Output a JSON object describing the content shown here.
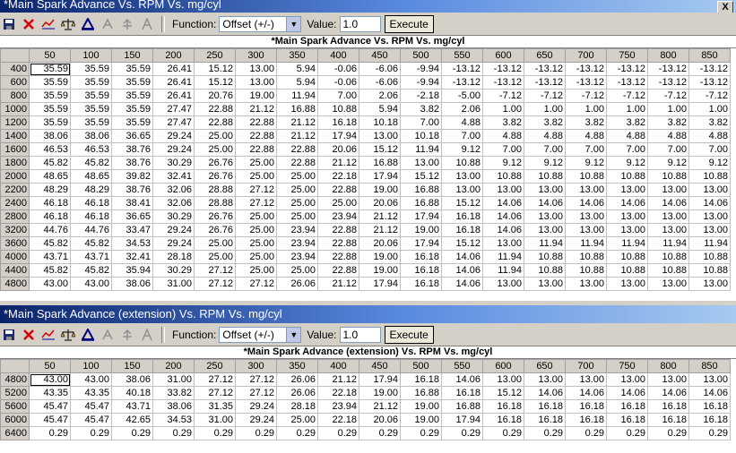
{
  "toolbar": {
    "function_label": "Function:",
    "function_value": "Offset (+/-)",
    "value_label": "Value:",
    "value_value": "1.0",
    "execute_label": "Execute",
    "close_glyph": "X"
  },
  "columns": [
    "50",
    "100",
    "150",
    "200",
    "250",
    "300",
    "350",
    "400",
    "450",
    "500",
    "550",
    "600",
    "650",
    "700",
    "750",
    "800",
    "850"
  ],
  "window1": {
    "title": "*Main Spark Advance Vs. RPM Vs. mg/cyl",
    "table_title": "*Main Spark Advance Vs. RPM Vs. mg/cyl",
    "rows": [
      {
        "rpm": "400",
        "values": [
          "35.59",
          "35.59",
          "35.59",
          "26.41",
          "15.12",
          "13.00",
          "5.94",
          "-0.06",
          "-6.06",
          "-9.94",
          "-13.12",
          "-13.12",
          "-13.12",
          "-13.12",
          "-13.12",
          "-13.12",
          "-13.12"
        ]
      },
      {
        "rpm": "600",
        "values": [
          "35.59",
          "35.59",
          "35.59",
          "26.41",
          "15.12",
          "13.00",
          "5.94",
          "-0.06",
          "-6.06",
          "-9.94",
          "-13.12",
          "-13.12",
          "-13.12",
          "-13.12",
          "-13.12",
          "-13.12",
          "-13.12"
        ]
      },
      {
        "rpm": "800",
        "values": [
          "35.59",
          "35.59",
          "35.59",
          "26.41",
          "20.76",
          "19.00",
          "11.94",
          "7.00",
          "2.06",
          "-2.18",
          "-5.00",
          "-7.12",
          "-7.12",
          "-7.12",
          "-7.12",
          "-7.12",
          "-7.12"
        ]
      },
      {
        "rpm": "1000",
        "values": [
          "35.59",
          "35.59",
          "35.59",
          "27.47",
          "22.88",
          "21.12",
          "16.88",
          "10.88",
          "5.94",
          "3.82",
          "2.06",
          "1.00",
          "1.00",
          "1.00",
          "1.00",
          "1.00",
          "1.00"
        ]
      },
      {
        "rpm": "1200",
        "values": [
          "35.59",
          "35.59",
          "35.59",
          "27.47",
          "22.88",
          "22.88",
          "21.12",
          "16.18",
          "10.18",
          "7.00",
          "4.88",
          "3.82",
          "3.82",
          "3.82",
          "3.82",
          "3.82",
          "3.82"
        ]
      },
      {
        "rpm": "1400",
        "values": [
          "38.06",
          "38.06",
          "36.65",
          "29.24",
          "25.00",
          "22.88",
          "21.12",
          "17.94",
          "13.00",
          "10.18",
          "7.00",
          "4.88",
          "4.88",
          "4.88",
          "4.88",
          "4.88",
          "4.88"
        ]
      },
      {
        "rpm": "1600",
        "values": [
          "46.53",
          "46.53",
          "38.76",
          "29.24",
          "25.00",
          "22.88",
          "22.88",
          "20.06",
          "15.12",
          "11.94",
          "9.12",
          "7.00",
          "7.00",
          "7.00",
          "7.00",
          "7.00",
          "7.00"
        ]
      },
      {
        "rpm": "1800",
        "values": [
          "45.82",
          "45.82",
          "38.76",
          "30.29",
          "26.76",
          "25.00",
          "22.88",
          "21.12",
          "16.88",
          "13.00",
          "10.88",
          "9.12",
          "9.12",
          "9.12",
          "9.12",
          "9.12",
          "9.12"
        ]
      },
      {
        "rpm": "2000",
        "values": [
          "48.65",
          "48.65",
          "39.82",
          "32.41",
          "26.76",
          "25.00",
          "25.00",
          "22.18",
          "17.94",
          "15.12",
          "13.00",
          "10.88",
          "10.88",
          "10.88",
          "10.88",
          "10.88",
          "10.88"
        ]
      },
      {
        "rpm": "2200",
        "values": [
          "48.29",
          "48.29",
          "38.76",
          "32.06",
          "28.88",
          "27.12",
          "25.00",
          "22.88",
          "19.00",
          "16.88",
          "13.00",
          "13.00",
          "13.00",
          "13.00",
          "13.00",
          "13.00",
          "13.00"
        ]
      },
      {
        "rpm": "2400",
        "values": [
          "46.18",
          "46.18",
          "38.41",
          "32.06",
          "28.88",
          "27.12",
          "25.00",
          "25.00",
          "20.06",
          "16.88",
          "15.12",
          "14.06",
          "14.06",
          "14.06",
          "14.06",
          "14.06",
          "14.06"
        ]
      },
      {
        "rpm": "2800",
        "values": [
          "46.18",
          "46.18",
          "36.65",
          "30.29",
          "26.76",
          "25.00",
          "25.00",
          "23.94",
          "21.12",
          "17.94",
          "16.18",
          "14.06",
          "13.00",
          "13.00",
          "13.00",
          "13.00",
          "13.00"
        ]
      },
      {
        "rpm": "3200",
        "values": [
          "44.76",
          "44.76",
          "33.47",
          "29.24",
          "26.76",
          "25.00",
          "23.94",
          "22.88",
          "21.12",
          "19.00",
          "16.18",
          "14.06",
          "13.00",
          "13.00",
          "13.00",
          "13.00",
          "13.00"
        ]
      },
      {
        "rpm": "3600",
        "values": [
          "45.82",
          "45.82",
          "34.53",
          "29.24",
          "25.00",
          "25.00",
          "23.94",
          "22.88",
          "20.06",
          "17.94",
          "15.12",
          "13.00",
          "11.94",
          "11.94",
          "11.94",
          "11.94",
          "11.94"
        ]
      },
      {
        "rpm": "4000",
        "values": [
          "43.71",
          "43.71",
          "32.41",
          "28.18",
          "25.00",
          "25.00",
          "23.94",
          "22.88",
          "19.00",
          "16.18",
          "14.06",
          "11.94",
          "10.88",
          "10.88",
          "10.88",
          "10.88",
          "10.88"
        ]
      },
      {
        "rpm": "4400",
        "values": [
          "45.82",
          "45.82",
          "35.94",
          "30.29",
          "27.12",
          "25.00",
          "25.00",
          "22.88",
          "19.00",
          "16.18",
          "14.06",
          "11.94",
          "10.88",
          "10.88",
          "10.88",
          "10.88",
          "10.88"
        ]
      },
      {
        "rpm": "4800",
        "values": [
          "43.00",
          "43.00",
          "38.06",
          "31.00",
          "27.12",
          "27.12",
          "26.06",
          "21.12",
          "17.94",
          "16.18",
          "14.06",
          "13.00",
          "13.00",
          "13.00",
          "13.00",
          "13.00",
          "13.00"
        ]
      }
    ]
  },
  "window2": {
    "title": "*Main Spark Advance (extension) Vs. RPM Vs. mg/cyl",
    "table_title": "*Main Spark Advance (extension) Vs. RPM Vs. mg/cyl",
    "rows": [
      {
        "rpm": "4800",
        "values": [
          "43.00",
          "43.00",
          "38.06",
          "31.00",
          "27.12",
          "27.12",
          "26.06",
          "21.12",
          "17.94",
          "16.18",
          "14.06",
          "13.00",
          "13.00",
          "13.00",
          "13.00",
          "13.00",
          "13.00"
        ]
      },
      {
        "rpm": "5200",
        "values": [
          "43.35",
          "43.35",
          "40.18",
          "33.82",
          "27.12",
          "27.12",
          "26.06",
          "22.18",
          "19.00",
          "16.88",
          "16.18",
          "15.12",
          "14.06",
          "14.06",
          "14.06",
          "14.06",
          "14.06"
        ]
      },
      {
        "rpm": "5600",
        "values": [
          "45.47",
          "45.47",
          "43.71",
          "38.06",
          "31.35",
          "29.24",
          "28.18",
          "23.94",
          "21.12",
          "19.00",
          "16.88",
          "16.18",
          "16.18",
          "16.18",
          "16.18",
          "16.18",
          "16.18"
        ]
      },
      {
        "rpm": "6000",
        "values": [
          "45.47",
          "45.47",
          "42.65",
          "34.53",
          "31.00",
          "29.24",
          "25.00",
          "22.18",
          "20.06",
          "19.00",
          "17.94",
          "16.18",
          "16.18",
          "16.18",
          "16.18",
          "16.18",
          "16.18"
        ]
      },
      {
        "rpm": "6400",
        "values": [
          "0.29",
          "0.29",
          "0.29",
          "0.29",
          "0.29",
          "0.29",
          "0.29",
          "0.29",
          "0.29",
          "0.29",
          "0.29",
          "0.29",
          "0.29",
          "0.29",
          "0.29",
          "0.29",
          "0.29"
        ]
      }
    ]
  }
}
